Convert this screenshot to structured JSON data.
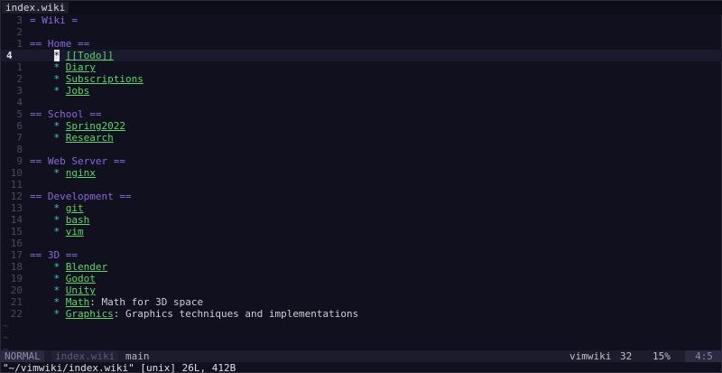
{
  "tab": {
    "label": "index.wiki"
  },
  "lines": [
    {
      "num": "3",
      "parts": [
        {
          "t": "= Wiki =",
          "c": "hdr"
        }
      ]
    },
    {
      "num": "2",
      "parts": []
    },
    {
      "num": "1",
      "parts": [
        {
          "t": "== Home ==",
          "c": "hdr"
        }
      ]
    },
    {
      "num": "4",
      "current": true,
      "parts": [
        {
          "t": "    ",
          "c": "plain"
        },
        {
          "t": "*",
          "c": "cursor"
        },
        {
          "t": " ",
          "c": "plain"
        },
        {
          "t": "[[Todo]]",
          "c": "link"
        }
      ]
    },
    {
      "num": "1",
      "parts": [
        {
          "t": "    * ",
          "c": "bullet"
        },
        {
          "t": "Diary",
          "c": "link"
        }
      ]
    },
    {
      "num": "2",
      "parts": [
        {
          "t": "    * ",
          "c": "bullet"
        },
        {
          "t": "Subscriptions",
          "c": "link"
        }
      ]
    },
    {
      "num": "3",
      "parts": [
        {
          "t": "    * ",
          "c": "bullet"
        },
        {
          "t": "Jobs",
          "c": "link"
        }
      ]
    },
    {
      "num": "4",
      "parts": []
    },
    {
      "num": "5",
      "parts": [
        {
          "t": "== School ==",
          "c": "hdr"
        }
      ]
    },
    {
      "num": "6",
      "parts": [
        {
          "t": "    * ",
          "c": "bullet"
        },
        {
          "t": "Spring2022",
          "c": "link"
        }
      ]
    },
    {
      "num": "7",
      "parts": [
        {
          "t": "    * ",
          "c": "bullet"
        },
        {
          "t": "Research",
          "c": "link"
        }
      ]
    },
    {
      "num": "8",
      "parts": []
    },
    {
      "num": "9",
      "parts": [
        {
          "t": "== Web Server ==",
          "c": "hdr"
        }
      ]
    },
    {
      "num": "10",
      "parts": [
        {
          "t": "    * ",
          "c": "bullet"
        },
        {
          "t": "nginx",
          "c": "link"
        }
      ]
    },
    {
      "num": "11",
      "parts": []
    },
    {
      "num": "12",
      "parts": [
        {
          "t": "== Development ==",
          "c": "hdr"
        }
      ]
    },
    {
      "num": "13",
      "parts": [
        {
          "t": "    * ",
          "c": "bullet"
        },
        {
          "t": "git",
          "c": "link"
        }
      ]
    },
    {
      "num": "14",
      "parts": [
        {
          "t": "    * ",
          "c": "bullet"
        },
        {
          "t": "bash",
          "c": "link"
        }
      ]
    },
    {
      "num": "15",
      "parts": [
        {
          "t": "    * ",
          "c": "bullet"
        },
        {
          "t": "vim",
          "c": "link"
        }
      ]
    },
    {
      "num": "16",
      "parts": []
    },
    {
      "num": "17",
      "parts": [
        {
          "t": "== 3D ==",
          "c": "hdr"
        }
      ]
    },
    {
      "num": "18",
      "parts": [
        {
          "t": "    * ",
          "c": "bullet"
        },
        {
          "t": "Blender",
          "c": "link"
        }
      ]
    },
    {
      "num": "19",
      "parts": [
        {
          "t": "    * ",
          "c": "bullet"
        },
        {
          "t": "Godot",
          "c": "link"
        }
      ]
    },
    {
      "num": "20",
      "parts": [
        {
          "t": "    * ",
          "c": "bullet"
        },
        {
          "t": "Unity",
          "c": "link"
        }
      ]
    },
    {
      "num": "21",
      "parts": [
        {
          "t": "    * ",
          "c": "bullet"
        },
        {
          "t": "Math",
          "c": "link"
        },
        {
          "t": ": Math for 3D space",
          "c": "plain"
        }
      ]
    },
    {
      "num": "22",
      "parts": [
        {
          "t": "    * ",
          "c": "bullet"
        },
        {
          "t": "Graphics",
          "c": "link"
        },
        {
          "t": ": Graphics techniques and implementations",
          "c": "plain"
        }
      ]
    }
  ],
  "tildes": [
    "~",
    "~",
    "~"
  ],
  "statusline": {
    "mode": "NORMAL",
    "file": "index.wiki",
    "branch": "main",
    "filetype": "vimwiki",
    "col": "32",
    "percent": "15%",
    "position": "4:5"
  },
  "cmdline": "\"~/vimwiki/index.wiki\" [unix] 26L, 412B",
  "colors": {
    "background": "#10101e",
    "header": "#8a6ad8",
    "bullet": "#4fc3c9",
    "link": "#5fd66a"
  }
}
